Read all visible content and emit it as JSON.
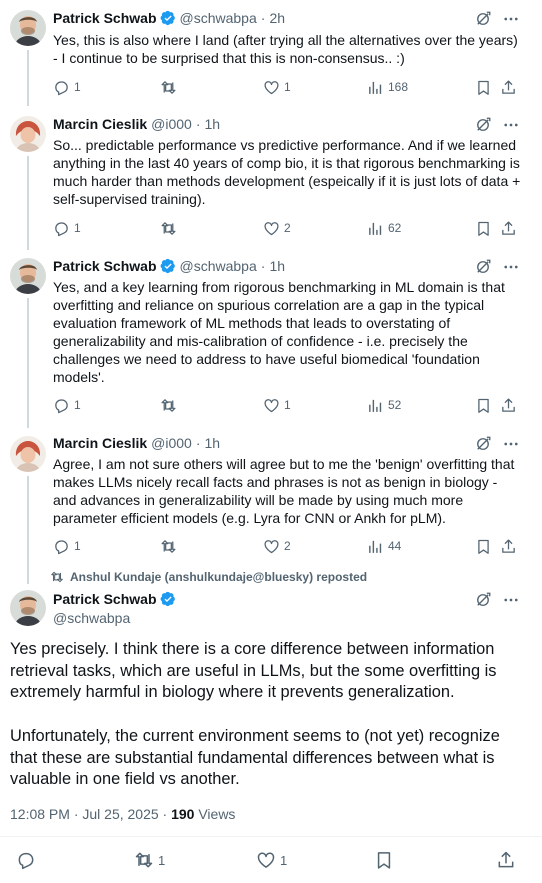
{
  "accent": "#1d9bf0",
  "icons": {
    "verified": "verified-badge-icon",
    "grok": "grok-icon",
    "more": "more-icon",
    "reply": "reply-icon",
    "repost": "repost-icon",
    "like": "like-icon",
    "views": "views-icon",
    "bookmark": "bookmark-icon",
    "share": "share-icon"
  },
  "replies": [
    {
      "name": "Patrick Schwab",
      "handle": "@schwabpa",
      "time": "2h",
      "verified": true,
      "text": "Yes, this is also where I land (after trying all the alternatives over the years) - I continue to be surprised that this is non-consensus.. :)",
      "reply_count": "1",
      "repost_count": "",
      "like_count": "1",
      "views": "168"
    },
    {
      "name": "Marcin Cieslik",
      "handle": "@i000",
      "time": "1h",
      "verified": false,
      "text": "So... predictable performance vs predictive performance. And if we learned anything in the last 40 years of comp bio, it is that rigorous benchmarking is much harder than methods development (espeically if it is just lots of data + self-supervised training).",
      "reply_count": "1",
      "repost_count": "",
      "like_count": "2",
      "views": "62"
    },
    {
      "name": "Patrick Schwab",
      "handle": "@schwabpa",
      "time": "1h",
      "verified": true,
      "text": "Yes, and a key learning from rigorous benchmarking in ML domain is that overfitting and reliance on spurious correlation are a gap in the typical evaluation framework of ML methods that leads to overstating of generalizability and mis-calibration of confidence - i.e. precisely the challenges we need to address to have useful biomedical 'foundation models'.",
      "reply_count": "1",
      "repost_count": "",
      "like_count": "1",
      "views": "52"
    },
    {
      "name": "Marcin Cieslik",
      "handle": "@i000",
      "time": "1h",
      "verified": false,
      "text": "Agree, I am not sure others will agree but to me the 'benign' overfitting that makes LLMs nicely recall facts and phrases is not as benign in biology - and advances in generalizability will be made by using much more parameter efficient models (e.g. Lyra for CNN or Ankh for pLM).",
      "reply_count": "1",
      "repost_count": "",
      "like_count": "2",
      "views": "44"
    }
  ],
  "main_post": {
    "reposted_by": "Anshul Kundaje (anshulkundaje@bluesky) reposted",
    "name": "Patrick Schwab",
    "handle": "@schwabpa",
    "paragraph_1": "Yes precisely. I think there is a core difference between information retrieval tasks, which are useful in LLMs, but the some overfitting is extremely harmful in biology where it prevents generalization.",
    "paragraph_2": "Unfortunately, the current environment seems to (not yet) recognize that these are substantial fundamental differences between what is valuable in one field vs another.",
    "timestamp": "12:08 PM · Jul 25, 2025 · ",
    "views_count": "190",
    "views_label": " Views",
    "reply_count": "",
    "repost_count": "1",
    "like_count": "1"
  }
}
